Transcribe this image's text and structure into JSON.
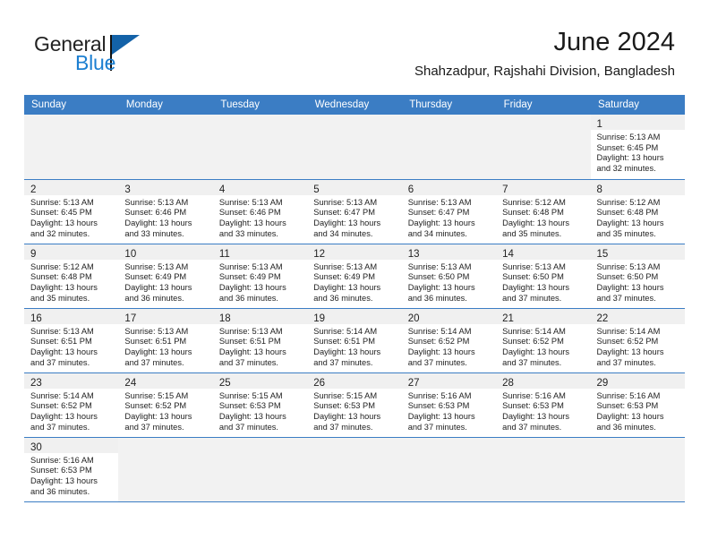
{
  "brand": {
    "name_part1": "General",
    "name_part2": "Blue",
    "accent_color": "#1c7fd1",
    "flag_color": "#1362a8"
  },
  "header": {
    "month_title": "June 2024",
    "location": "Shahzadpur, Rajshahi Division, Bangladesh"
  },
  "calendar": {
    "header_bg": "#3b7dc4",
    "weekday_headers": [
      "Sunday",
      "Monday",
      "Tuesday",
      "Wednesday",
      "Thursday",
      "Friday",
      "Saturday"
    ],
    "weeks": [
      [
        {
          "empty": true
        },
        {
          "empty": true
        },
        {
          "empty": true
        },
        {
          "empty": true
        },
        {
          "empty": true
        },
        {
          "empty": true
        },
        {
          "day": "1",
          "sunrise": "Sunrise: 5:13 AM",
          "sunset": "Sunset: 6:45 PM",
          "daylight1": "Daylight: 13 hours",
          "daylight2": "and 32 minutes."
        }
      ],
      [
        {
          "day": "2",
          "sunrise": "Sunrise: 5:13 AM",
          "sunset": "Sunset: 6:45 PM",
          "daylight1": "Daylight: 13 hours",
          "daylight2": "and 32 minutes."
        },
        {
          "day": "3",
          "sunrise": "Sunrise: 5:13 AM",
          "sunset": "Sunset: 6:46 PM",
          "daylight1": "Daylight: 13 hours",
          "daylight2": "and 33 minutes."
        },
        {
          "day": "4",
          "sunrise": "Sunrise: 5:13 AM",
          "sunset": "Sunset: 6:46 PM",
          "daylight1": "Daylight: 13 hours",
          "daylight2": "and 33 minutes."
        },
        {
          "day": "5",
          "sunrise": "Sunrise: 5:13 AM",
          "sunset": "Sunset: 6:47 PM",
          "daylight1": "Daylight: 13 hours",
          "daylight2": "and 34 minutes."
        },
        {
          "day": "6",
          "sunrise": "Sunrise: 5:13 AM",
          "sunset": "Sunset: 6:47 PM",
          "daylight1": "Daylight: 13 hours",
          "daylight2": "and 34 minutes."
        },
        {
          "day": "7",
          "sunrise": "Sunrise: 5:12 AM",
          "sunset": "Sunset: 6:48 PM",
          "daylight1": "Daylight: 13 hours",
          "daylight2": "and 35 minutes."
        },
        {
          "day": "8",
          "sunrise": "Sunrise: 5:12 AM",
          "sunset": "Sunset: 6:48 PM",
          "daylight1": "Daylight: 13 hours",
          "daylight2": "and 35 minutes."
        }
      ],
      [
        {
          "day": "9",
          "sunrise": "Sunrise: 5:12 AM",
          "sunset": "Sunset: 6:48 PM",
          "daylight1": "Daylight: 13 hours",
          "daylight2": "and 35 minutes."
        },
        {
          "day": "10",
          "sunrise": "Sunrise: 5:13 AM",
          "sunset": "Sunset: 6:49 PM",
          "daylight1": "Daylight: 13 hours",
          "daylight2": "and 36 minutes."
        },
        {
          "day": "11",
          "sunrise": "Sunrise: 5:13 AM",
          "sunset": "Sunset: 6:49 PM",
          "daylight1": "Daylight: 13 hours",
          "daylight2": "and 36 minutes."
        },
        {
          "day": "12",
          "sunrise": "Sunrise: 5:13 AM",
          "sunset": "Sunset: 6:49 PM",
          "daylight1": "Daylight: 13 hours",
          "daylight2": "and 36 minutes."
        },
        {
          "day": "13",
          "sunrise": "Sunrise: 5:13 AM",
          "sunset": "Sunset: 6:50 PM",
          "daylight1": "Daylight: 13 hours",
          "daylight2": "and 36 minutes."
        },
        {
          "day": "14",
          "sunrise": "Sunrise: 5:13 AM",
          "sunset": "Sunset: 6:50 PM",
          "daylight1": "Daylight: 13 hours",
          "daylight2": "and 37 minutes."
        },
        {
          "day": "15",
          "sunrise": "Sunrise: 5:13 AM",
          "sunset": "Sunset: 6:50 PM",
          "daylight1": "Daylight: 13 hours",
          "daylight2": "and 37 minutes."
        }
      ],
      [
        {
          "day": "16",
          "sunrise": "Sunrise: 5:13 AM",
          "sunset": "Sunset: 6:51 PM",
          "daylight1": "Daylight: 13 hours",
          "daylight2": "and 37 minutes."
        },
        {
          "day": "17",
          "sunrise": "Sunrise: 5:13 AM",
          "sunset": "Sunset: 6:51 PM",
          "daylight1": "Daylight: 13 hours",
          "daylight2": "and 37 minutes."
        },
        {
          "day": "18",
          "sunrise": "Sunrise: 5:13 AM",
          "sunset": "Sunset: 6:51 PM",
          "daylight1": "Daylight: 13 hours",
          "daylight2": "and 37 minutes."
        },
        {
          "day": "19",
          "sunrise": "Sunrise: 5:14 AM",
          "sunset": "Sunset: 6:51 PM",
          "daylight1": "Daylight: 13 hours",
          "daylight2": "and 37 minutes."
        },
        {
          "day": "20",
          "sunrise": "Sunrise: 5:14 AM",
          "sunset": "Sunset: 6:52 PM",
          "daylight1": "Daylight: 13 hours",
          "daylight2": "and 37 minutes."
        },
        {
          "day": "21",
          "sunrise": "Sunrise: 5:14 AM",
          "sunset": "Sunset: 6:52 PM",
          "daylight1": "Daylight: 13 hours",
          "daylight2": "and 37 minutes."
        },
        {
          "day": "22",
          "sunrise": "Sunrise: 5:14 AM",
          "sunset": "Sunset: 6:52 PM",
          "daylight1": "Daylight: 13 hours",
          "daylight2": "and 37 minutes."
        }
      ],
      [
        {
          "day": "23",
          "sunrise": "Sunrise: 5:14 AM",
          "sunset": "Sunset: 6:52 PM",
          "daylight1": "Daylight: 13 hours",
          "daylight2": "and 37 minutes."
        },
        {
          "day": "24",
          "sunrise": "Sunrise: 5:15 AM",
          "sunset": "Sunset: 6:52 PM",
          "daylight1": "Daylight: 13 hours",
          "daylight2": "and 37 minutes."
        },
        {
          "day": "25",
          "sunrise": "Sunrise: 5:15 AM",
          "sunset": "Sunset: 6:53 PM",
          "daylight1": "Daylight: 13 hours",
          "daylight2": "and 37 minutes."
        },
        {
          "day": "26",
          "sunrise": "Sunrise: 5:15 AM",
          "sunset": "Sunset: 6:53 PM",
          "daylight1": "Daylight: 13 hours",
          "daylight2": "and 37 minutes."
        },
        {
          "day": "27",
          "sunrise": "Sunrise: 5:16 AM",
          "sunset": "Sunset: 6:53 PM",
          "daylight1": "Daylight: 13 hours",
          "daylight2": "and 37 minutes."
        },
        {
          "day": "28",
          "sunrise": "Sunrise: 5:16 AM",
          "sunset": "Sunset: 6:53 PM",
          "daylight1": "Daylight: 13 hours",
          "daylight2": "and 37 minutes."
        },
        {
          "day": "29",
          "sunrise": "Sunrise: 5:16 AM",
          "sunset": "Sunset: 6:53 PM",
          "daylight1": "Daylight: 13 hours",
          "daylight2": "and 36 minutes."
        }
      ],
      [
        {
          "day": "30",
          "sunrise": "Sunrise: 5:16 AM",
          "sunset": "Sunset: 6:53 PM",
          "daylight1": "Daylight: 13 hours",
          "daylight2": "and 36 minutes."
        },
        {
          "empty": true
        },
        {
          "empty": true
        },
        {
          "empty": true
        },
        {
          "empty": true
        },
        {
          "empty": true
        },
        {
          "empty": true
        }
      ]
    ]
  }
}
